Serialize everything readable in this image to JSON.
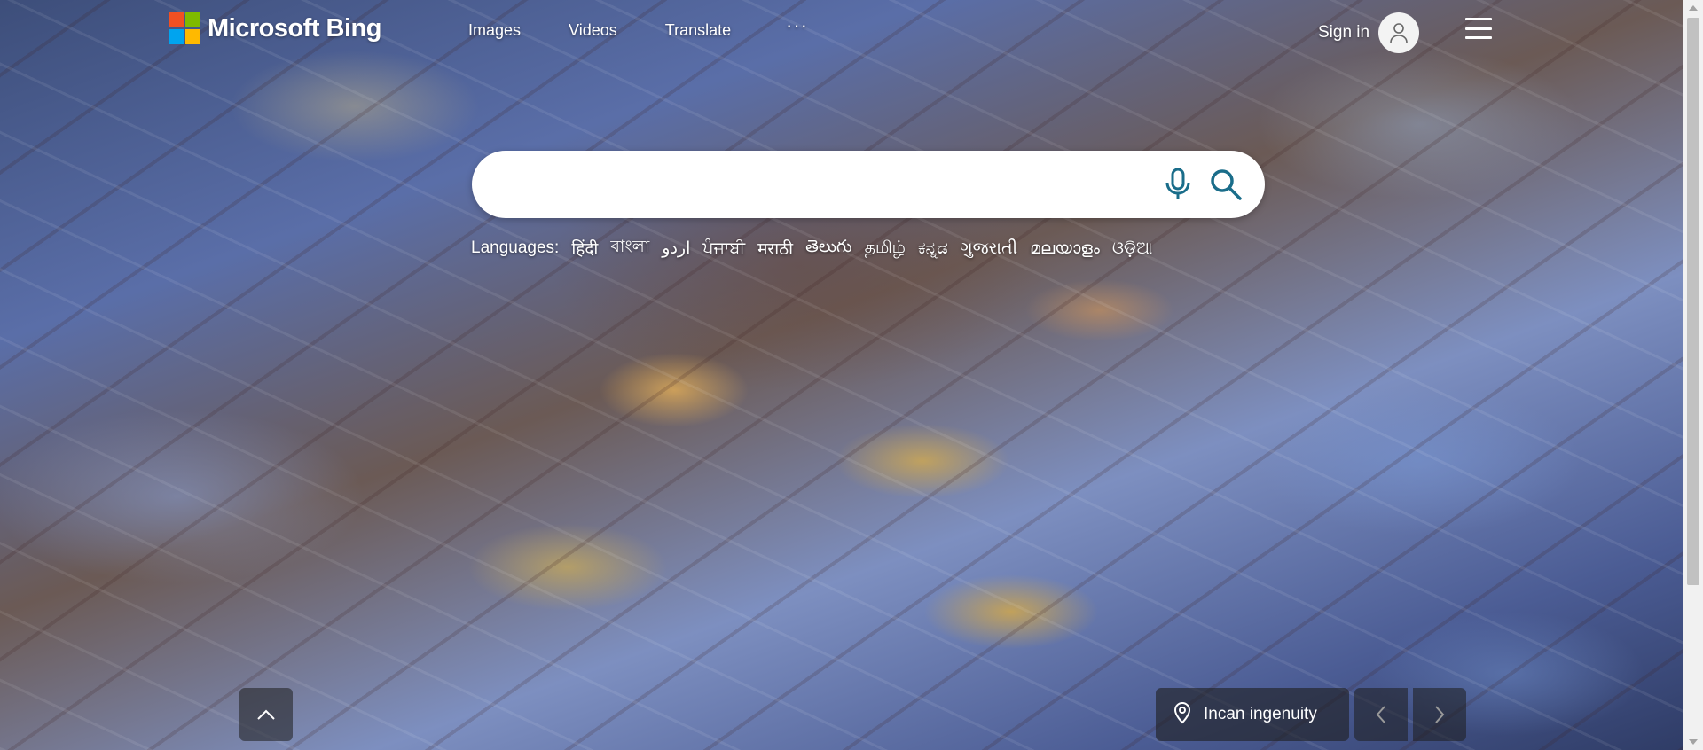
{
  "brand": {
    "name": "Microsoft Bing",
    "colors": [
      "#f25022",
      "#7fba00",
      "#00a4ef",
      "#ffb900"
    ]
  },
  "nav": {
    "items": [
      "Images",
      "Videos",
      "Translate"
    ],
    "more": "···"
  },
  "account": {
    "sign_in": "Sign in",
    "avatar_icon": "person-icon"
  },
  "menu_icon": "hamburger-icon",
  "search": {
    "value": "",
    "placeholder": "",
    "mic_icon": "microphone-icon",
    "search_icon": "search-icon"
  },
  "languages": {
    "label": "Languages:",
    "items": [
      "हिंदी",
      "বাংলা",
      "اردو",
      "ਪੰਜਾਬੀ",
      "मराठी",
      "తెలుగు",
      "தமிழ்",
      "ಕನ್ನಡ",
      "ગુજરાતી",
      "മലയാളം",
      "ଓଡ଼ିଆ"
    ]
  },
  "footer": {
    "scroll_up_icon": "chevron-up-icon",
    "caption": "Incan ingenuity",
    "location_icon": "location-pin-icon",
    "prev_icon": "chevron-left-icon",
    "next_icon": "chevron-right-icon"
  }
}
